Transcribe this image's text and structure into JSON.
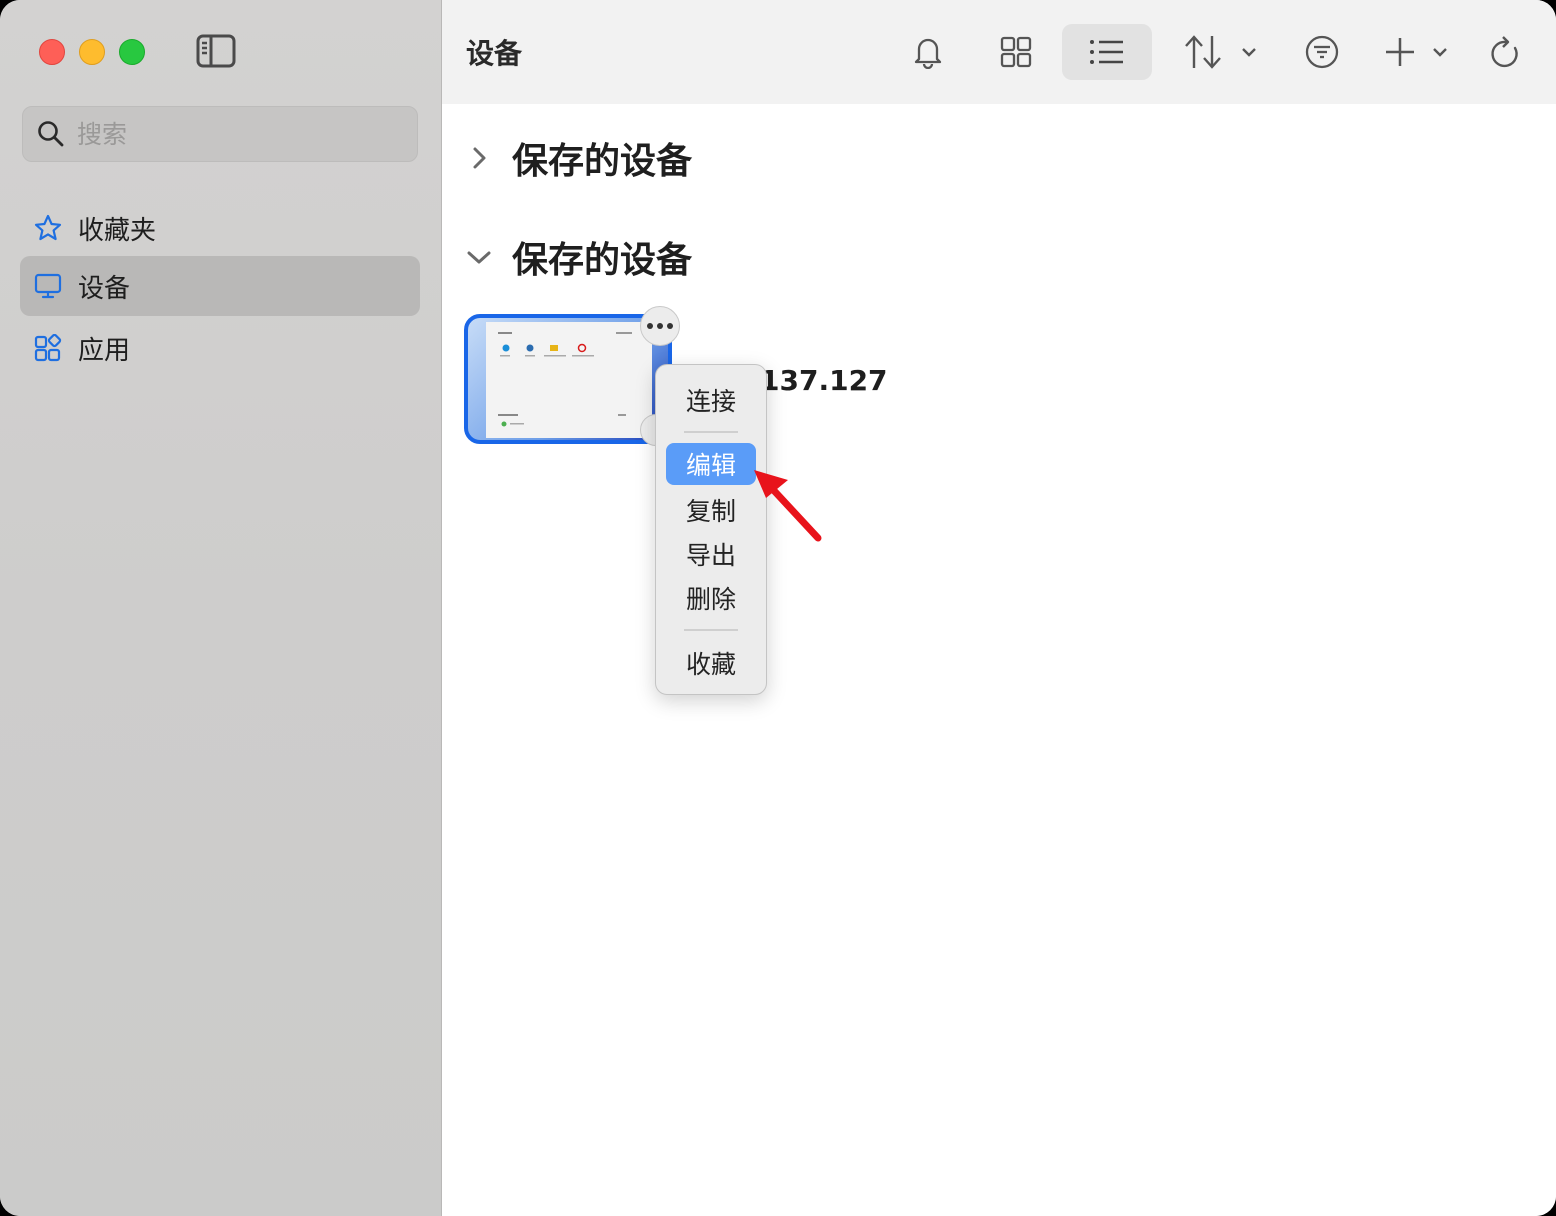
{
  "sidebar": {
    "search": {
      "placeholder": "搜索",
      "value": ""
    },
    "items": [
      {
        "label": "收藏夹",
        "icon": "star-icon"
      },
      {
        "label": "设备",
        "icon": "monitor-icon",
        "selected": true
      },
      {
        "label": "应用",
        "icon": "apps-icon"
      }
    ]
  },
  "toolbar": {
    "title": "设备",
    "buttons": [
      "bell-icon",
      "grid-view-icon",
      "list-view-icon",
      "sort-icon",
      "filter-icon",
      "add-icon",
      "refresh-icon"
    ]
  },
  "sections": [
    {
      "label": "保存的设备",
      "expanded": false
    },
    {
      "label": "保存的设备",
      "expanded": true
    }
  ],
  "device": {
    "name": "137.127"
  },
  "context_menu": {
    "items": [
      "连接",
      "编辑",
      "复制",
      "导出",
      "删除",
      "收藏"
    ],
    "highlighted": "编辑"
  },
  "colors": {
    "accent": "#1966e8",
    "menu_highlight": "#5a9cf8",
    "pointer_arrow": "#e8131b"
  }
}
